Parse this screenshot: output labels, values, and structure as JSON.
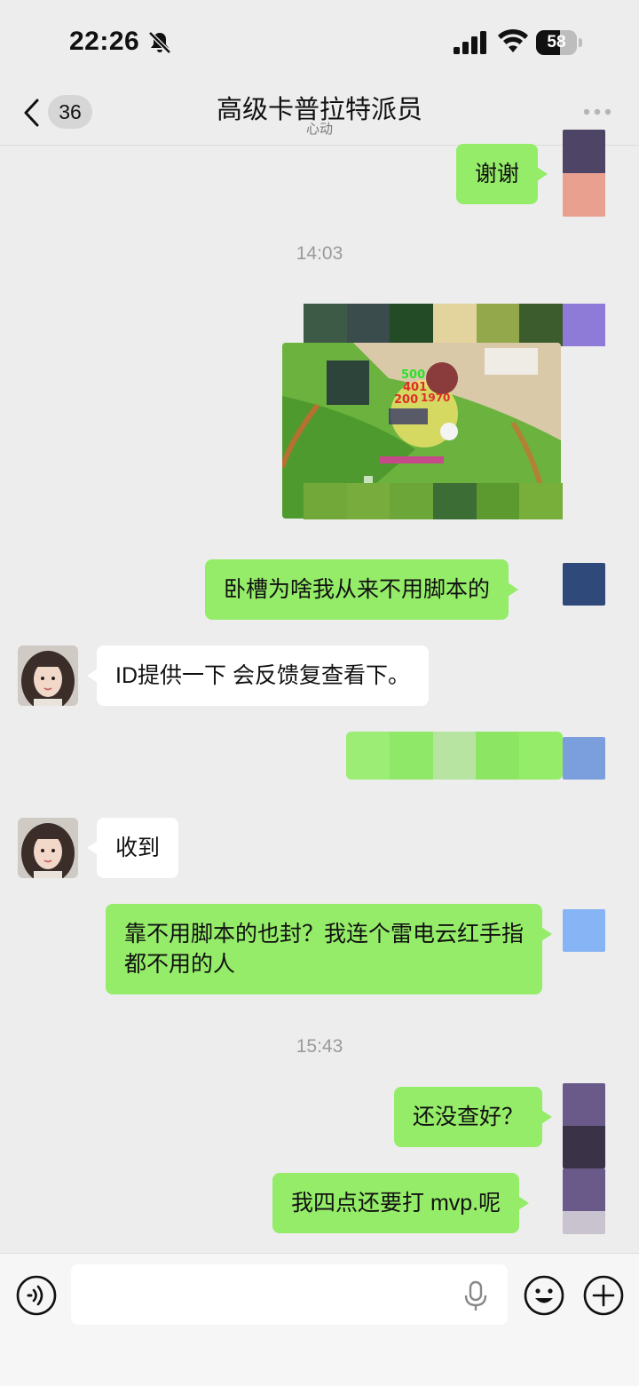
{
  "status_bar": {
    "time": "22:26",
    "battery": "58",
    "battery_level": 0.58
  },
  "nav": {
    "back_label": "",
    "unread_count": "36",
    "title": "高级卡普拉特派员",
    "subtitle": "心动"
  },
  "messages": [
    {
      "type": "text",
      "from": "me",
      "text": "谢谢"
    },
    {
      "type": "timestamp",
      "text": "14:03"
    },
    {
      "type": "image",
      "from": "me",
      "image_numbers": [
        "500",
        "401",
        "200",
        "1970"
      ]
    },
    {
      "type": "text",
      "from": "me",
      "text": "卧槽为啥我从来不用脚本的"
    },
    {
      "type": "text",
      "from": "them",
      "text": "ID提供一下 会反馈复查看下。"
    },
    {
      "type": "redacted",
      "from": "me"
    },
    {
      "type": "text",
      "from": "them",
      "text": "收到"
    },
    {
      "type": "text",
      "from": "me",
      "text": "靠不用脚本的也封？我连个雷电云红手指都不用的人"
    },
    {
      "type": "timestamp",
      "text": "15:43"
    },
    {
      "type": "text",
      "from": "me",
      "text": "还没查好？"
    },
    {
      "type": "text",
      "from": "me",
      "text": "我四点还要打 mvp.呢"
    }
  ],
  "input": {
    "placeholder": ""
  },
  "colors": {
    "my_bubble": "#95ec69",
    "their_bubble": "#ffffff",
    "background": "#ededed",
    "input_bar": "#f6f6f6"
  },
  "icons": [
    "bell-off-icon",
    "signal-icon",
    "wifi-icon",
    "battery-icon",
    "back-icon",
    "more-icon",
    "voice-icon",
    "mic-icon",
    "emoji-icon",
    "plus-icon"
  ]
}
